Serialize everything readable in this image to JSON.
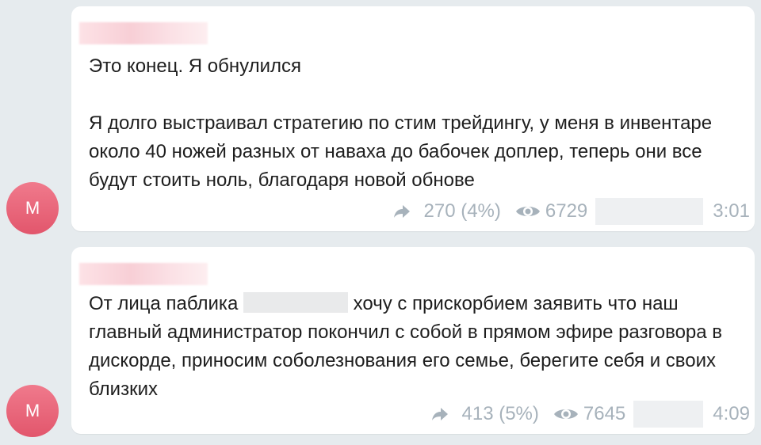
{
  "messages": [
    {
      "avatar_letter": "M",
      "text": "Это конец. Я обнулился\n\nЯ долго выстраивал стратегию по стим трейдингу, у меня в инвентаре около 40 ножей разных от наваха до бабочек доплер, теперь они все будут стоить ноль, благодаря новой обнове",
      "shares": "270 (4%)",
      "views": "6729",
      "time": "3:01"
    },
    {
      "avatar_letter": "M",
      "text_before": "От лица паблика",
      "text_after": "хочу с прискорбием заявить что наш главный администратор покончил с собой в прямом эфире разговора в дискорде, приносим соболезнования его семье, берегите себя и своих близких",
      "shares": "413 (5%)",
      "views": "7645",
      "time": "4:09"
    }
  ],
  "colors": {
    "background": "#e6ebee",
    "bubble": "#ffffff",
    "avatar": "#e2566c",
    "meta": "#a7b2bb"
  },
  "icons": [
    "share-icon",
    "eye-icon"
  ]
}
